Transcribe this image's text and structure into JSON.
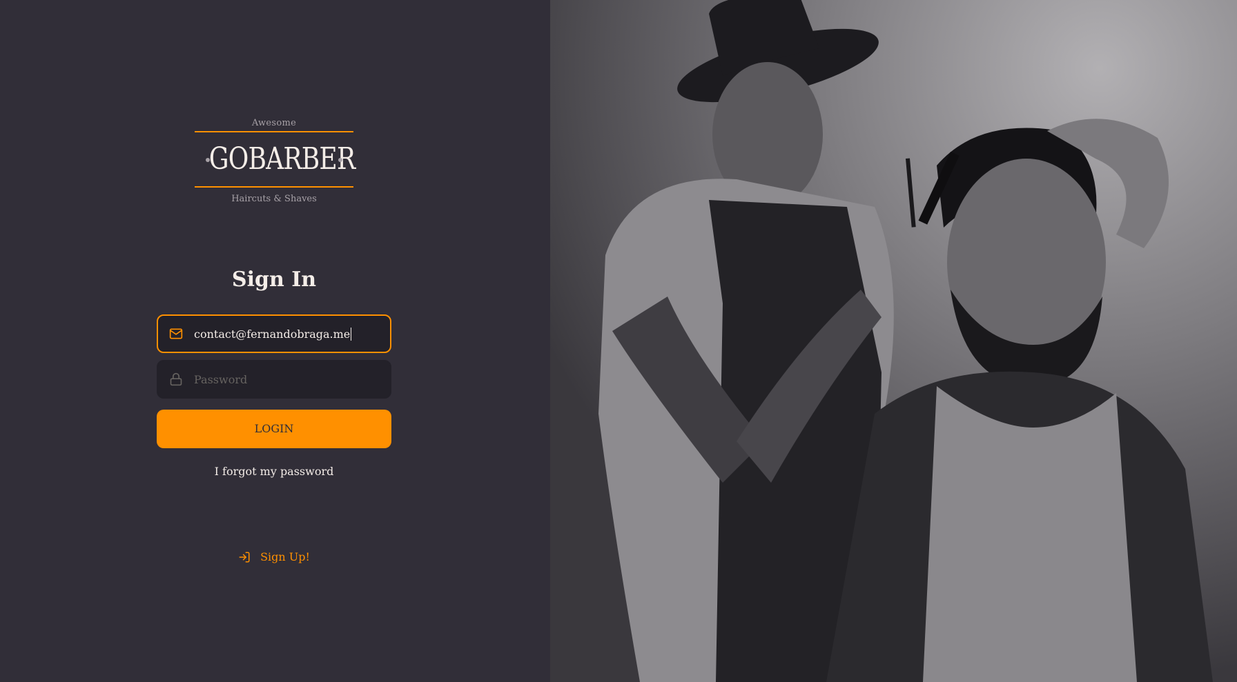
{
  "brand": {
    "top_text": "Awesome",
    "name": "GOBARBER",
    "tagline": "Haircuts & Shaves"
  },
  "form": {
    "title": "Sign In",
    "email": {
      "value": "contact@fernandobraga.me",
      "icon": "mail-icon"
    },
    "password": {
      "placeholder": "Password",
      "icon": "lock-icon"
    },
    "login_label": "LOGIN",
    "forgot_label": "I forgot my password"
  },
  "signup": {
    "label": "Sign Up!",
    "icon": "log-in-icon"
  },
  "hero_image": {
    "description_icon": "photo-barber"
  },
  "colors": {
    "background": "#312e38",
    "accent": "#ff9000",
    "input_bg": "#232129",
    "text": "#f4ede8",
    "placeholder": "#666360"
  }
}
